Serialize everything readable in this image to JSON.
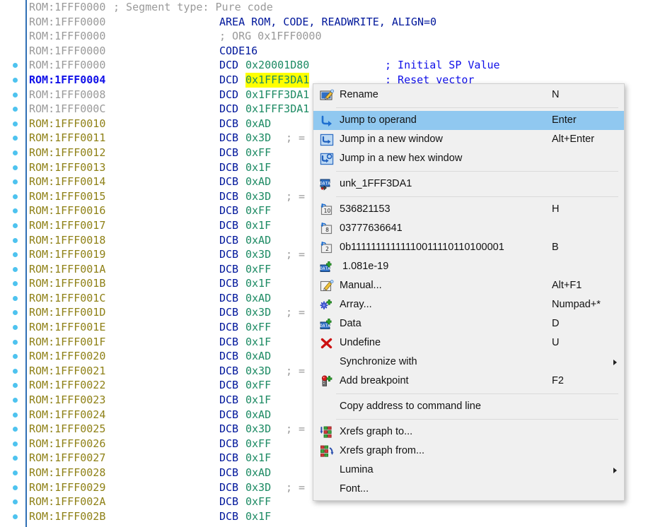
{
  "disassembly": {
    "segment_prefix": "ROM:",
    "rows": [
      {
        "bp": false,
        "addr": "ROM:1FFF0000",
        "addr_style": "gray",
        "kind": "segment_comment",
        "text": "; Segment type: Pure code"
      },
      {
        "bp": false,
        "addr": "ROM:1FFF0000",
        "addr_style": "gray",
        "kind": "directive",
        "text": "AREA ROM, CODE, READWRITE, ALIGN=0"
      },
      {
        "bp": false,
        "addr": "ROM:1FFF0000",
        "addr_style": "gray",
        "kind": "org_comment",
        "text": "; ORG 0x1FFF0000"
      },
      {
        "bp": false,
        "addr": "ROM:1FFF0000",
        "addr_style": "gray",
        "kind": "directive",
        "text": "CODE16"
      },
      {
        "bp": true,
        "addr": "ROM:1FFF0000",
        "addr_style": "gray",
        "kind": "data",
        "mnem": "DCD",
        "operand": "0x20001D80",
        "highlight": false,
        "comment": "; Initial SP Value"
      },
      {
        "bp": true,
        "addr": "ROM:1FFF0004",
        "addr_style": "selected",
        "kind": "data",
        "mnem": "DCD",
        "operand": "0x1FFF3DA1",
        "highlight": true,
        "comment": "; Reset vector"
      },
      {
        "bp": true,
        "addr": "ROM:1FFF0008",
        "addr_style": "gray",
        "kind": "data",
        "mnem": "DCD",
        "operand": "0x1FFF3DA1",
        "highlight": false,
        "comment": ""
      },
      {
        "bp": true,
        "addr": "ROM:1FFF000C",
        "addr_style": "gray",
        "kind": "data",
        "mnem": "DCD",
        "operand": "0x1FFF3DA1",
        "highlight": false,
        "comment": ""
      },
      {
        "bp": true,
        "addr": "ROM:1FFF0010",
        "addr_style": "olive",
        "kind": "data",
        "mnem": "DCB",
        "operand": "0xAD",
        "highlight": false,
        "comment": ""
      },
      {
        "bp": true,
        "addr": "ROM:1FFF0011",
        "addr_style": "olive",
        "kind": "data",
        "mnem": "DCB",
        "operand": "0x3D",
        "highlight": false,
        "trailing": "; ="
      },
      {
        "bp": true,
        "addr": "ROM:1FFF0012",
        "addr_style": "olive",
        "kind": "data",
        "mnem": "DCB",
        "operand": "0xFF",
        "highlight": false,
        "comment": ""
      },
      {
        "bp": true,
        "addr": "ROM:1FFF0013",
        "addr_style": "olive",
        "kind": "data",
        "mnem": "DCB",
        "operand": "0x1F",
        "highlight": false,
        "comment": ""
      },
      {
        "bp": true,
        "addr": "ROM:1FFF0014",
        "addr_style": "olive",
        "kind": "data",
        "mnem": "DCB",
        "operand": "0xAD",
        "highlight": false,
        "comment": ""
      },
      {
        "bp": true,
        "addr": "ROM:1FFF0015",
        "addr_style": "olive",
        "kind": "data",
        "mnem": "DCB",
        "operand": "0x3D",
        "highlight": false,
        "trailing": "; ="
      },
      {
        "bp": true,
        "addr": "ROM:1FFF0016",
        "addr_style": "olive",
        "kind": "data",
        "mnem": "DCB",
        "operand": "0xFF",
        "highlight": false,
        "comment": ""
      },
      {
        "bp": true,
        "addr": "ROM:1FFF0017",
        "addr_style": "olive",
        "kind": "data",
        "mnem": "DCB",
        "operand": "0x1F",
        "highlight": false,
        "comment": ""
      },
      {
        "bp": true,
        "addr": "ROM:1FFF0018",
        "addr_style": "olive",
        "kind": "data",
        "mnem": "DCB",
        "operand": "0xAD",
        "highlight": false,
        "comment": ""
      },
      {
        "bp": true,
        "addr": "ROM:1FFF0019",
        "addr_style": "olive",
        "kind": "data",
        "mnem": "DCB",
        "operand": "0x3D",
        "highlight": false,
        "trailing": "; ="
      },
      {
        "bp": true,
        "addr": "ROM:1FFF001A",
        "addr_style": "olive",
        "kind": "data",
        "mnem": "DCB",
        "operand": "0xFF",
        "highlight": false,
        "comment": ""
      },
      {
        "bp": true,
        "addr": "ROM:1FFF001B",
        "addr_style": "olive",
        "kind": "data",
        "mnem": "DCB",
        "operand": "0x1F",
        "highlight": false,
        "comment": ""
      },
      {
        "bp": true,
        "addr": "ROM:1FFF001C",
        "addr_style": "olive",
        "kind": "data",
        "mnem": "DCB",
        "operand": "0xAD",
        "highlight": false,
        "comment": ""
      },
      {
        "bp": true,
        "addr": "ROM:1FFF001D",
        "addr_style": "olive",
        "kind": "data",
        "mnem": "DCB",
        "operand": "0x3D",
        "highlight": false,
        "trailing": "; ="
      },
      {
        "bp": true,
        "addr": "ROM:1FFF001E",
        "addr_style": "olive",
        "kind": "data",
        "mnem": "DCB",
        "operand": "0xFF",
        "highlight": false,
        "comment": ""
      },
      {
        "bp": true,
        "addr": "ROM:1FFF001F",
        "addr_style": "olive",
        "kind": "data",
        "mnem": "DCB",
        "operand": "0x1F",
        "highlight": false,
        "comment": ""
      },
      {
        "bp": true,
        "addr": "ROM:1FFF0020",
        "addr_style": "olive",
        "kind": "data",
        "mnem": "DCB",
        "operand": "0xAD",
        "highlight": false,
        "comment": ""
      },
      {
        "bp": true,
        "addr": "ROM:1FFF0021",
        "addr_style": "olive",
        "kind": "data",
        "mnem": "DCB",
        "operand": "0x3D",
        "highlight": false,
        "trailing": "; ="
      },
      {
        "bp": true,
        "addr": "ROM:1FFF0022",
        "addr_style": "olive",
        "kind": "data",
        "mnem": "DCB",
        "operand": "0xFF",
        "highlight": false,
        "comment": ""
      },
      {
        "bp": true,
        "addr": "ROM:1FFF0023",
        "addr_style": "olive",
        "kind": "data",
        "mnem": "DCB",
        "operand": "0x1F",
        "highlight": false,
        "comment": ""
      },
      {
        "bp": true,
        "addr": "ROM:1FFF0024",
        "addr_style": "olive",
        "kind": "data",
        "mnem": "DCB",
        "operand": "0xAD",
        "highlight": false,
        "comment": ""
      },
      {
        "bp": true,
        "addr": "ROM:1FFF0025",
        "addr_style": "olive",
        "kind": "data",
        "mnem": "DCB",
        "operand": "0x3D",
        "highlight": false,
        "trailing": "; ="
      },
      {
        "bp": true,
        "addr": "ROM:1FFF0026",
        "addr_style": "olive",
        "kind": "data",
        "mnem": "DCB",
        "operand": "0xFF",
        "highlight": false,
        "comment": ""
      },
      {
        "bp": true,
        "addr": "ROM:1FFF0027",
        "addr_style": "olive",
        "kind": "data",
        "mnem": "DCB",
        "operand": "0x1F",
        "highlight": false,
        "comment": ""
      },
      {
        "bp": true,
        "addr": "ROM:1FFF0028",
        "addr_style": "olive",
        "kind": "data",
        "mnem": "DCB",
        "operand": "0xAD",
        "highlight": false,
        "comment": ""
      },
      {
        "bp": true,
        "addr": "ROM:1FFF0029",
        "addr_style": "olive",
        "kind": "data",
        "mnem": "DCB",
        "operand": "0x3D",
        "highlight": false,
        "trailing": "; ="
      },
      {
        "bp": true,
        "addr": "ROM:1FFF002A",
        "addr_style": "olive",
        "kind": "data",
        "mnem": "DCB",
        "operand": "0xFF",
        "highlight": false,
        "comment": ""
      },
      {
        "bp": true,
        "addr": "ROM:1FFF002B",
        "addr_style": "olive",
        "kind": "data",
        "mnem": "DCB",
        "operand": "0x1F",
        "highlight": false,
        "comment": ""
      }
    ]
  },
  "context_menu": {
    "selected_index": 1,
    "items": [
      {
        "type": "item",
        "icon": "rename-icon",
        "label": "Rename",
        "accel": "N"
      },
      {
        "type": "separator"
      },
      {
        "type": "item",
        "icon": "jump-to-operand-icon",
        "label": "Jump to operand",
        "accel": "Enter",
        "selected": true
      },
      {
        "type": "item",
        "icon": "jump-new-window-icon",
        "label": "Jump in a new window",
        "accel": "Alt+Enter"
      },
      {
        "type": "item",
        "icon": "jump-new-hex-window-icon",
        "label": "Jump in a new hex window",
        "accel": ""
      },
      {
        "type": "separator"
      },
      {
        "type": "item",
        "icon": "data-symbol-icon",
        "label": "unk_1FFF3DA1",
        "accel": ""
      },
      {
        "type": "separator"
      },
      {
        "type": "item",
        "icon": "base-10-icon",
        "label": "536821153",
        "accel": "H"
      },
      {
        "type": "item",
        "icon": "base-8-icon",
        "label": "03777636641",
        "accel": ""
      },
      {
        "type": "item",
        "icon": "base-2-icon",
        "label": "0b11111111111110011110110100001",
        "accel": "B"
      },
      {
        "type": "item",
        "icon": "float-data-icon",
        "label": "1.081e-19",
        "accel": "",
        "indent": true
      },
      {
        "type": "item",
        "icon": "manual-icon",
        "label": "Manual...",
        "accel": "Alt+F1"
      },
      {
        "type": "item",
        "icon": "array-icon",
        "label": "Array...",
        "accel": "Numpad+*"
      },
      {
        "type": "item",
        "icon": "data-icon",
        "label": "Data",
        "accel": "D"
      },
      {
        "type": "item",
        "icon": "undefine-icon",
        "label": "Undefine",
        "accel": "U"
      },
      {
        "type": "item",
        "icon": "none",
        "label": "Synchronize with",
        "accel": "",
        "submenu": true
      },
      {
        "type": "item",
        "icon": "add-breakpoint-icon",
        "label": "Add breakpoint",
        "accel": "F2"
      },
      {
        "type": "separator"
      },
      {
        "type": "item",
        "icon": "none",
        "label": "Copy address to command line",
        "accel": ""
      },
      {
        "type": "separator"
      },
      {
        "type": "item",
        "icon": "xrefs-graph-to-icon",
        "label": "Xrefs graph to...",
        "accel": ""
      },
      {
        "type": "item",
        "icon": "xrefs-graph-from-icon",
        "label": "Xrefs graph from...",
        "accel": ""
      },
      {
        "type": "item",
        "icon": "none",
        "label": "Lumina",
        "accel": "",
        "submenu": true
      },
      {
        "type": "item",
        "icon": "none",
        "label": "Font...",
        "accel": ""
      }
    ]
  },
  "colors": {
    "address_default": "#9a9a9a",
    "address_olive": "#8f8117",
    "address_selected": "#1010e8",
    "mnemonic": "#00179b",
    "operand": "#1c8a63",
    "comment": "#1010e8",
    "highlight_bg": "#ffff00",
    "breakpoint_dot": "#4ec3ef",
    "menu_bg": "#f0f0f0",
    "menu_selected_bg": "#90c8f0"
  }
}
